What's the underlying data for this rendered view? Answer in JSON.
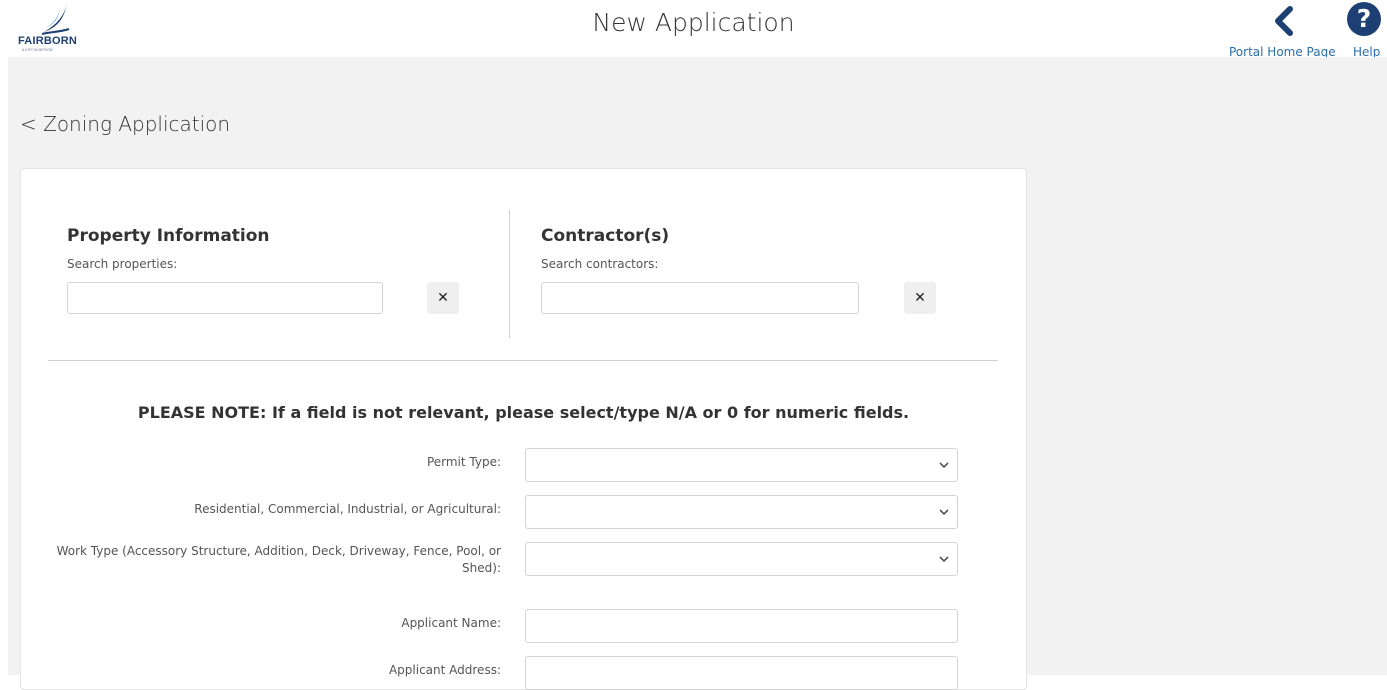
{
  "header": {
    "logo_text": "FAIRBORN",
    "logo_subtext": "A CITY IN MOTION",
    "page_title": "New Application",
    "nav": {
      "home_label": "Portal Home Page",
      "help_label": "Help"
    }
  },
  "main": {
    "back_link": "< Zoning Application",
    "property": {
      "title": "Property Information",
      "hint": "Search properties:",
      "search_value": "",
      "clear_label": "✕"
    },
    "contractors": {
      "title": "Contractor(s)",
      "hint": "Search contractors:",
      "search_value": "",
      "clear_label": "✕"
    },
    "note": "PLEASE NOTE: If a field is not relevant, please select/type N/A or 0 for numeric fields.",
    "fields": [
      {
        "label": "Permit Type:",
        "type": "select",
        "value": ""
      },
      {
        "label": "Residential, Commercial, Industrial, or Agricultural:",
        "type": "select",
        "value": ""
      },
      {
        "label": "Work Type (Accessory Structure, Addition, Deck, Driveway, Fence, Pool, or Shed):",
        "type": "select",
        "value": ""
      },
      {
        "label": "Applicant Name:",
        "type": "text",
        "value": ""
      },
      {
        "label": "Applicant Address:",
        "type": "text",
        "value": ""
      }
    ]
  },
  "colors": {
    "brand_navy": "#1d3f73",
    "link_blue": "#2a6ea8",
    "page_bg": "#f2f2f2"
  },
  "icons": {
    "logo": "fairborn-wing-logo",
    "home": "chevron-left-icon",
    "help": "question-circle-icon",
    "clear": "close-icon",
    "select": "chevron-down-icon"
  }
}
